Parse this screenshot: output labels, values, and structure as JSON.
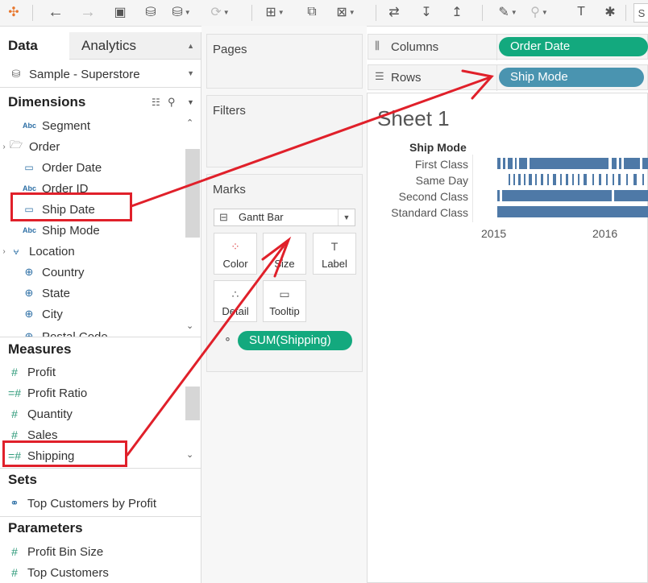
{
  "toolbar": {
    "icons": [
      "tableau-logo-icon",
      "undo-icon",
      "redo-icon",
      "save-icon",
      "new-datasource-icon",
      "pause-updates-icon",
      "refresh-icon",
      "new-worksheet-icon",
      "duplicate-sheet-icon",
      "clear-sheet-icon",
      "swap-icon",
      "sort-ascending-icon",
      "sort-descending-icon",
      "highlight-icon",
      "group-icon",
      "label-icon",
      "pin-icon"
    ],
    "cut_label": "S"
  },
  "data_pane": {
    "tab_data": "Data",
    "tab_analytics": "Analytics",
    "datasource": "Sample - Superstore",
    "dimensions_title": "Dimensions",
    "dimensions": [
      {
        "label": "Segment",
        "icon": "abc-icon"
      },
      {
        "label": "Order",
        "icon": "folder-icon"
      },
      {
        "label": "Order Date",
        "icon": "calendar-icon"
      },
      {
        "label": "Order ID",
        "icon": "abc-icon"
      },
      {
        "label": "Ship Date",
        "icon": "calendar-icon"
      },
      {
        "label": "Ship Mode",
        "icon": "abc-icon"
      },
      {
        "label": "Location",
        "icon": "hierarchy-icon"
      },
      {
        "label": "Country",
        "icon": "globe-icon"
      },
      {
        "label": "State",
        "icon": "globe-icon"
      },
      {
        "label": "City",
        "icon": "globe-icon"
      },
      {
        "label": "Postal Code",
        "icon": "globe-icon"
      }
    ],
    "measures_title": "Measures",
    "measures": [
      {
        "label": "Profit",
        "icon": "measure-icon"
      },
      {
        "label": "Profit Ratio",
        "icon": "calc-measure-icon"
      },
      {
        "label": "Quantity",
        "icon": "measure-icon"
      },
      {
        "label": "Sales",
        "icon": "measure-icon"
      },
      {
        "label": "Shipping",
        "icon": "calc-measure-icon"
      }
    ],
    "sets_title": "Sets",
    "sets": [
      {
        "label": "Top Customers by Profit",
        "icon": "set-icon"
      }
    ],
    "parameters_title": "Parameters",
    "parameters": [
      {
        "label": "Profit Bin Size",
        "icon": "parameter-icon"
      },
      {
        "label": "Top Customers",
        "icon": "parameter-icon"
      }
    ]
  },
  "cards": {
    "pages": "Pages",
    "filters": "Filters",
    "marks": "Marks",
    "mark_type": "Gantt Bar",
    "mark_buttons": [
      "Color",
      "Size",
      "Label",
      "Detail",
      "Tooltip"
    ],
    "size_pill": "SUM(Shipping)"
  },
  "shelves": {
    "columns_label": "Columns",
    "columns_pill": "Order Date",
    "rows_label": "Rows",
    "rows_pill": "Ship Mode"
  },
  "sheet": {
    "title": "Sheet 1",
    "row_header": "Ship Mode",
    "rows": [
      "First Class",
      "Same Day",
      "Second Class",
      "Standard Class"
    ],
    "x_ticks": [
      "2015",
      "2016"
    ]
  },
  "colors": {
    "accent_green": "#13a97e",
    "accent_blue": "#4a94b0",
    "mark_color": "#4e79a7",
    "annotation_red": "#e0202a"
  }
}
